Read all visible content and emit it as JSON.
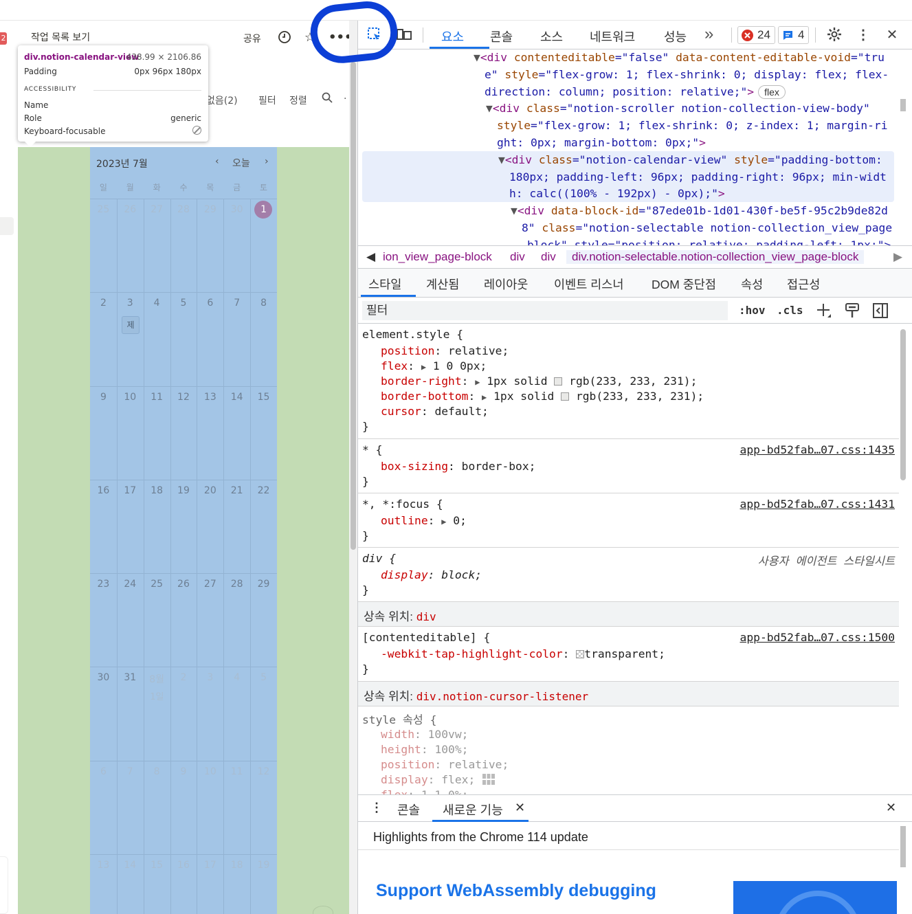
{
  "notion": {
    "badge": "2",
    "page_title": "작업 목록 보기",
    "share": "공유",
    "toolbar": {
      "no_group": "없음(2)",
      "filter": "필터",
      "sort": "정렬"
    }
  },
  "tooltip": {
    "element": "div.notion-calendar-view",
    "size": "438.99 × 2106.86",
    "padding_label": "Padding",
    "padding_value": "0px 96px 180px",
    "section": "ACCESSIBILITY",
    "name_label": "Name",
    "role_label": "Role",
    "role_value": "generic",
    "focus_label": "Keyboard-focusable"
  },
  "calendar": {
    "title": "2023년 7월",
    "today_button": "오늘",
    "weekdays": [
      "일",
      "월",
      "화",
      "수",
      "목",
      "금",
      "토"
    ],
    "weeks": [
      [
        "25",
        "26",
        "27",
        "28",
        "29",
        "30",
        "1"
      ],
      [
        "2",
        "3",
        "4",
        "5",
        "6",
        "7",
        "8"
      ],
      [
        "9",
        "10",
        "11",
        "12",
        "13",
        "14",
        "15"
      ],
      [
        "16",
        "17",
        "18",
        "19",
        "20",
        "21",
        "22"
      ],
      [
        "23",
        "24",
        "25",
        "26",
        "27",
        "28",
        "29"
      ],
      [
        "30",
        "31",
        "8월",
        "2",
        "3",
        "4",
        "5"
      ],
      [
        "6",
        "7",
        "8",
        "9",
        "10",
        "11",
        "12"
      ],
      [
        "13",
        "14",
        "15",
        "16",
        "17",
        "18",
        "19"
      ]
    ],
    "aug_sub": "1일",
    "event": "제"
  },
  "devtools": {
    "tabs": [
      "요소",
      "콘솔",
      "소스",
      "네트워크",
      "성능"
    ],
    "error_count": "24",
    "message_count": "4",
    "more": "»",
    "colors": {
      "accent": "#1a73e8",
      "error": "#d93025",
      "message": "#1a73e8"
    },
    "elements": {
      "l1a": "▼",
      "l1b": "<div ",
      "l1c": "contenteditable",
      "l1d": "=\"false\" ",
      "l1e": "data-content-editable-void",
      "l1f": "=\"tru",
      "l2": "e\" ",
      "l2b": "style",
      "l2c": "=\"flex-grow: 1; flex-shrink: 0; display: flex; flex-",
      "l3a": "direction: column; position: relative;\"",
      "l3b": ">",
      "l3chip": "flex",
      "l4a": "▼",
      "l4b": "<div ",
      "l4c": "class",
      "l4d": "=\"notion-scroller notion-collection-view-body\"",
      "l5a": "style",
      "l5b": "=\"flex-grow: 1; flex-shrink: 0; z-index: 1; margin-ri",
      "l6a": "ght: 0px; margin-bottom: 0px;\"",
      "l6b": ">",
      "l7a": "▼",
      "l7b": "<div ",
      "l7c": "class",
      "l7d": "=\"notion-calendar-view\" ",
      "l7e": "style",
      "l7f": "=\"padding-bottom:",
      "l8": "180px; padding-left: 96px; padding-right: 96px; min-widt",
      "l9a": "h: calc((100% - 192px) - 0px);\"",
      "l9b": ">",
      "l10a": "▼",
      "l10b": "<div ",
      "l10c": "data-block-id",
      "l10d": "=\"87ede01b-1d01-430f-be5f-95c2b9de82d",
      "l11a": "8\" ",
      "l11b": "class",
      "l11c": "=\"notion-selectable notion-collection_view_page",
      "l12": "block\" style=\"position: relative; padding-left: 1px;\">"
    },
    "breadcrumbs": [
      "ion_view_page-block",
      "div",
      "div",
      "div.notion-selectable.notion-collection_view_page-block"
    ],
    "subtabs": [
      "스타일",
      "계산됨",
      "레이아웃",
      "이벤트 리스너",
      "DOM 중단점",
      "속성",
      "접근성"
    ],
    "filter_placeholder": "필터",
    "hov": ":hov",
    "cls": ".cls",
    "styles": {
      "r1_sel": "element.style {",
      "r1_p1": "position",
      "r1_v1": "relative;",
      "r1_p2": "flex",
      "r1_v2": "1 0 0px;",
      "r1_p3": "border-right",
      "r1_v3": "1px solid ",
      "r1_v3b": "rgb(233, 233, 231);",
      "r1_p4": "border-bottom",
      "r1_v4": "1px solid ",
      "r1_v4b": "rgb(233, 233, 231);",
      "r1_p5": "cursor",
      "r1_v5": "default;",
      "close": "}",
      "r2_sel": "* {",
      "r2_src": "app-bd52fab…07.css:1435",
      "r2_p1": "box-sizing",
      "r2_v1": "border-box;",
      "r3_sel": "*, *:focus {",
      "r3_src": "app-bd52fab…07.css:1431",
      "r3_p1": "outline",
      "r3_v1": "0;",
      "r4_sel": "div {",
      "r4_src": "사용자 에이전트 스타일시트",
      "r4_p1": "display",
      "r4_v1": "block;",
      "inh1_label": "상속 위치: ",
      "inh1_cls": "div",
      "r5_sel": "[contenteditable] {",
      "r5_src": "app-bd52fab…07.css:1500",
      "r5_p1": "-webkit-tap-highlight-color",
      "r5_v1": "transparent;",
      "inh2_label": "상속 위치: ",
      "inh2_cls": "div.notion-cursor-listener",
      "r6_sel": "style 속성 {",
      "r6_p1": "width",
      "r6_v1": "100vw;",
      "r6_p2": "height",
      "r6_v2": "100%;",
      "r6_p3": "position",
      "r6_v3": "relative;",
      "r6_p4": "display",
      "r6_v4": "flex;",
      "r6_p5": "flex",
      "r6_v5": "1 1 0%;"
    },
    "drawer": {
      "tabs": [
        "콘솔",
        "새로운 기능"
      ],
      "subtitle": "Highlights from the Chrome 114 update",
      "headline": "Support WebAssembly debugging"
    }
  }
}
